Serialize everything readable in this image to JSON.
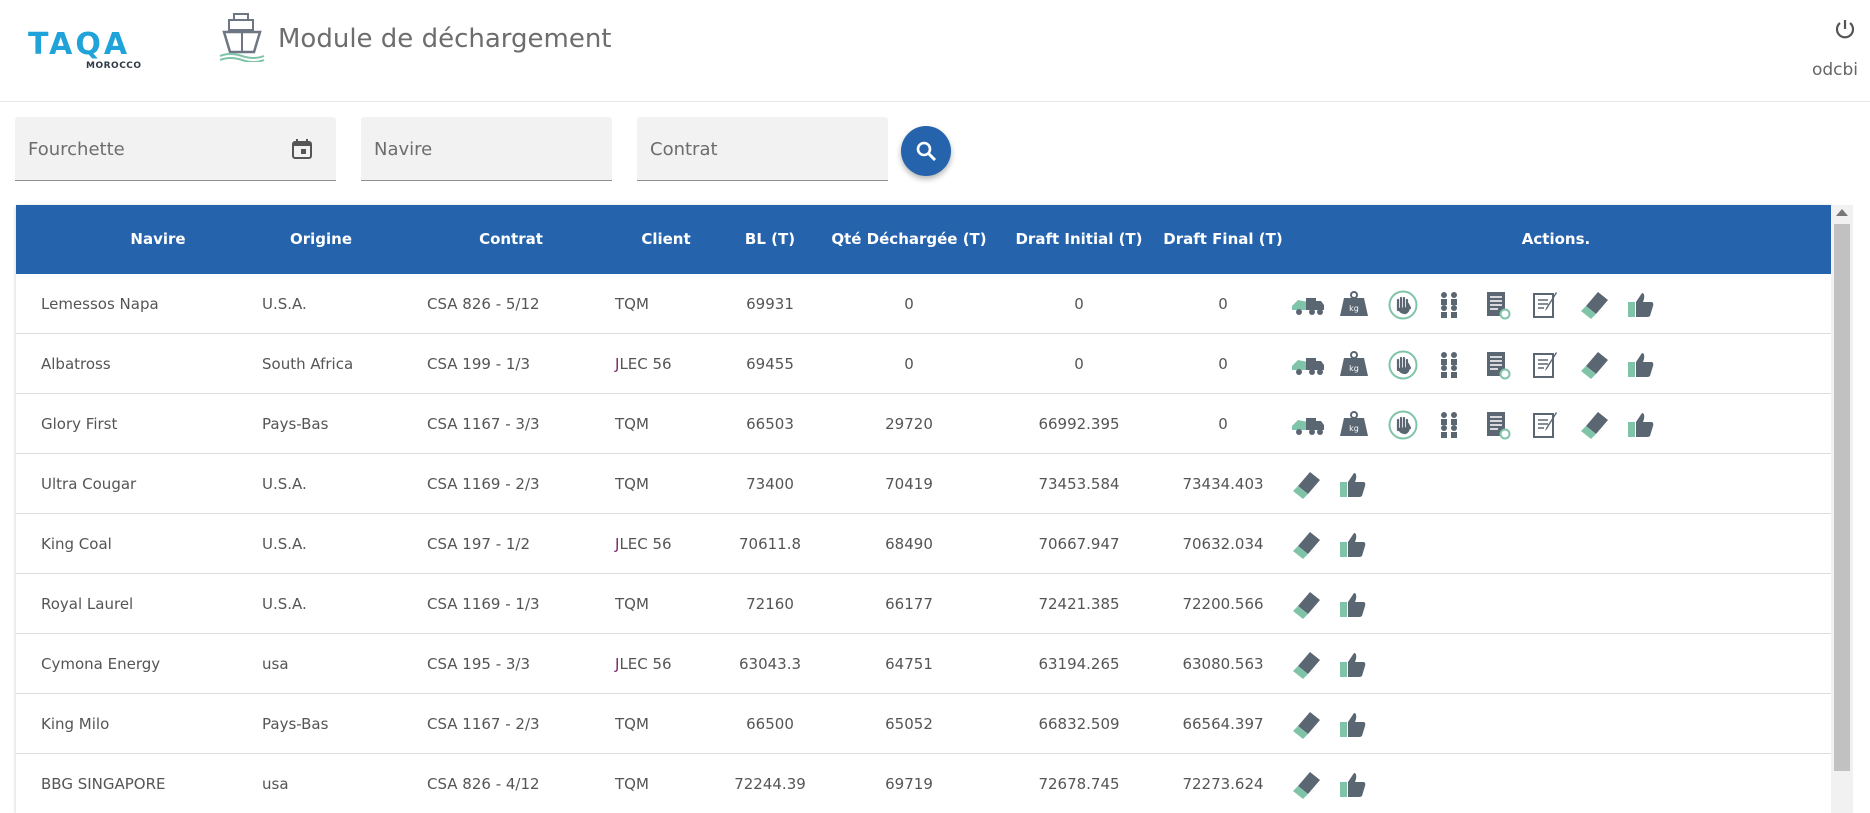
{
  "header": {
    "logo_main": "TAQA",
    "logo_sub": "MOROCCO",
    "module_title": "Module de déchargement",
    "username": "odcbi"
  },
  "filters": {
    "fourchette_placeholder": "Fourchette",
    "navire_placeholder": "Navire",
    "contrat_placeholder": "Contrat"
  },
  "table": {
    "headers": [
      "Navire",
      "Origine",
      "Contrat",
      "Client",
      "BL (T)",
      "Qté Déchargée (T)",
      "Draft Initial (T)",
      "Draft Final (T)",
      "Actions."
    ],
    "rows": [
      {
        "navire": "Lemessos Napa",
        "origine": "U.S.A.",
        "contrat": "CSA 826 - 5/12",
        "client": "TQM",
        "bl": "69931",
        "qte": "0",
        "draft_initial": "0",
        "draft_final": "0",
        "actions": [
          "truck-icon",
          "weight-icon",
          "hand-stop-icon",
          "team-icon",
          "report-icon",
          "edit-note-icon",
          "eraser-icon",
          "thumbs-up-icon"
        ]
      },
      {
        "navire": "Albatross",
        "origine": "South Africa",
        "contrat": "CSA 199 - 1/3",
        "client": "JLEC 56",
        "bl": "69455",
        "qte": "0",
        "draft_initial": "0",
        "draft_final": "0",
        "actions": [
          "truck-icon",
          "weight-icon",
          "hand-stop-icon",
          "team-icon",
          "report-icon",
          "edit-note-icon",
          "eraser-icon",
          "thumbs-up-icon"
        ]
      },
      {
        "navire": "Glory First",
        "origine": "Pays-Bas",
        "contrat": "CSA 1167 - 3/3",
        "client": "TQM",
        "bl": "66503",
        "qte": "29720",
        "draft_initial": "66992.395",
        "draft_final": "0",
        "actions": [
          "truck-icon",
          "weight-icon",
          "hand-stop-icon",
          "team-icon",
          "report-icon",
          "edit-note-icon",
          "eraser-icon",
          "thumbs-up-icon"
        ]
      },
      {
        "navire": "Ultra Cougar",
        "origine": "U.S.A.",
        "contrat": "CSA 1169 - 2/3",
        "client": "TQM",
        "bl": "73400",
        "qte": "70419",
        "draft_initial": "73453.584",
        "draft_final": "73434.403",
        "actions": [
          "eraser-icon",
          "thumbs-up-icon"
        ]
      },
      {
        "navire": "King Coal",
        "origine": "U.S.A.",
        "contrat": "CSA 197 - 1/2",
        "client": "JLEC 56",
        "bl": "70611.8",
        "qte": "68490",
        "draft_initial": "70667.947",
        "draft_final": "70632.034",
        "actions": [
          "eraser-icon",
          "thumbs-up-icon"
        ]
      },
      {
        "navire": "Royal Laurel",
        "origine": "U.S.A.",
        "contrat": "CSA 1169 - 1/3",
        "client": "TQM",
        "bl": "72160",
        "qte": "66177",
        "draft_initial": "72421.385",
        "draft_final": "72200.566",
        "actions": [
          "eraser-icon",
          "thumbs-up-icon"
        ]
      },
      {
        "navire": "Cymona Energy",
        "origine": "usa",
        "contrat": "CSA 195 - 3/3",
        "client": "JLEC 56",
        "bl": "63043.3",
        "qte": "64751",
        "draft_initial": "63194.265",
        "draft_final": "63080.563",
        "actions": [
          "eraser-icon",
          "thumbs-up-icon"
        ]
      },
      {
        "navire": "King Milo",
        "origine": "Pays-Bas",
        "contrat": "CSA 1167 - 2/3",
        "client": "TQM",
        "bl": "66500",
        "qte": "65052",
        "draft_initial": "66832.509",
        "draft_final": "66564.397",
        "actions": [
          "eraser-icon",
          "thumbs-up-icon"
        ]
      },
      {
        "navire": "BBG SINGAPORE",
        "origine": "usa",
        "contrat": "CSA 826 - 4/12",
        "client": "TQM",
        "bl": "72244.39",
        "qte": "69719",
        "draft_initial": "72678.745",
        "draft_final": "72273.624",
        "actions": [
          "eraser-icon",
          "thumbs-up-icon"
        ]
      }
    ]
  },
  "colors": {
    "primary": "#2563ad",
    "icon_gray": "#5b6673",
    "icon_green": "#7fc4a9",
    "client_accent": "#7b2a6a"
  }
}
